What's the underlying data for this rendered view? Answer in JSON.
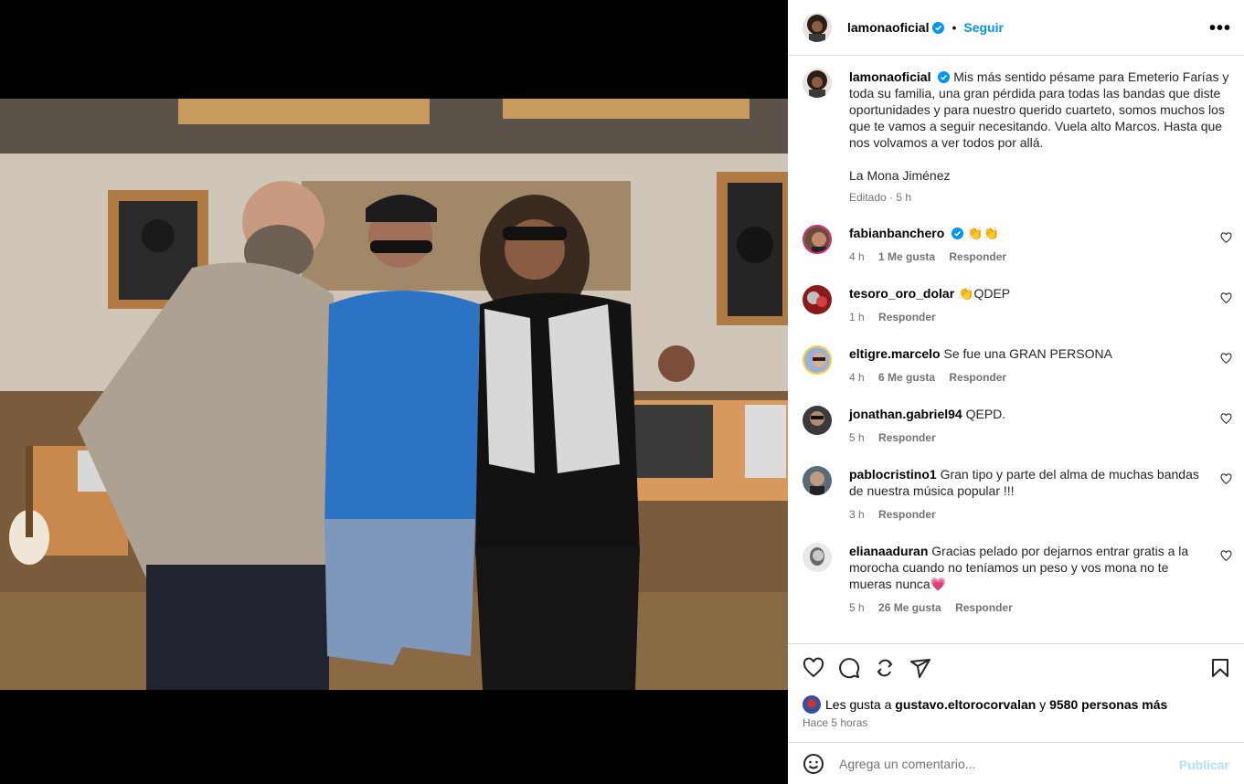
{
  "post": {
    "author": "lamonaoficial",
    "dot": "•",
    "follow_label": "Seguir",
    "more_label": "•••",
    "caption_text": "Mis más sentido pésame para Emeterio Farías y toda su familia, una gran pérdida para todas las bandas que diste oportunidades y para nuestro querido cuarteto, somos muchos los que te vamos a seguir necesitando. Vuela alto Marcos. Hasta que nos volvamos a ver todos por allá.\n\nLa Mona Jiménez",
    "caption_meta": "Editado · 5 h"
  },
  "comments": [
    {
      "user": "fabianbanchero",
      "verified": true,
      "text": "👏👏",
      "time": "4 h",
      "likes": "1 Me gusta",
      "reply": "Responder"
    },
    {
      "user": "tesoro_oro_dolar",
      "verified": false,
      "text": "👏QDEP",
      "time": "1 h",
      "likes": "",
      "reply": "Responder"
    },
    {
      "user": "eltigre.marcelo",
      "verified": false,
      "text": "Se fue una GRAN PERSONA",
      "time": "4 h",
      "likes": "6 Me gusta",
      "reply": "Responder"
    },
    {
      "user": "jonathan.gabriel94",
      "verified": false,
      "text": "QEPD.",
      "time": "5 h",
      "likes": "",
      "reply": "Responder"
    },
    {
      "user": "pablocristino1",
      "verified": false,
      "text": "Gran tipo y parte del alma de muchas bandas de nuestra música popular !!!",
      "time": "3 h",
      "likes": "",
      "reply": "Responder"
    },
    {
      "user": "elianaaduran",
      "verified": false,
      "text": "Gracias pelado por dejarnos entrar gratis a la morocha cuando no teníamos un peso y vos mona no te mueras nunca💗",
      "time": "5 h",
      "likes": "26 Me gusta",
      "reply": "Responder"
    }
  ],
  "likes_summary": {
    "prefix": "Les gusta a",
    "user": "gustavo.eltorocorvalan",
    "conj": "y",
    "others": "9580 personas más"
  },
  "time_ago": "Hace 5 horas",
  "compose": {
    "placeholder": "Agrega un comentario...",
    "publish_label": "Publicar"
  },
  "icons": [
    "heart-icon",
    "comment-icon",
    "repost-icon",
    "share-icon",
    "bookmark-icon",
    "emoji-icon",
    "more-icon"
  ],
  "colors": {
    "link": "#0095f6",
    "publish_disabled": "#b2dffc",
    "verified": "#0095f6",
    "meta": "#737373"
  }
}
